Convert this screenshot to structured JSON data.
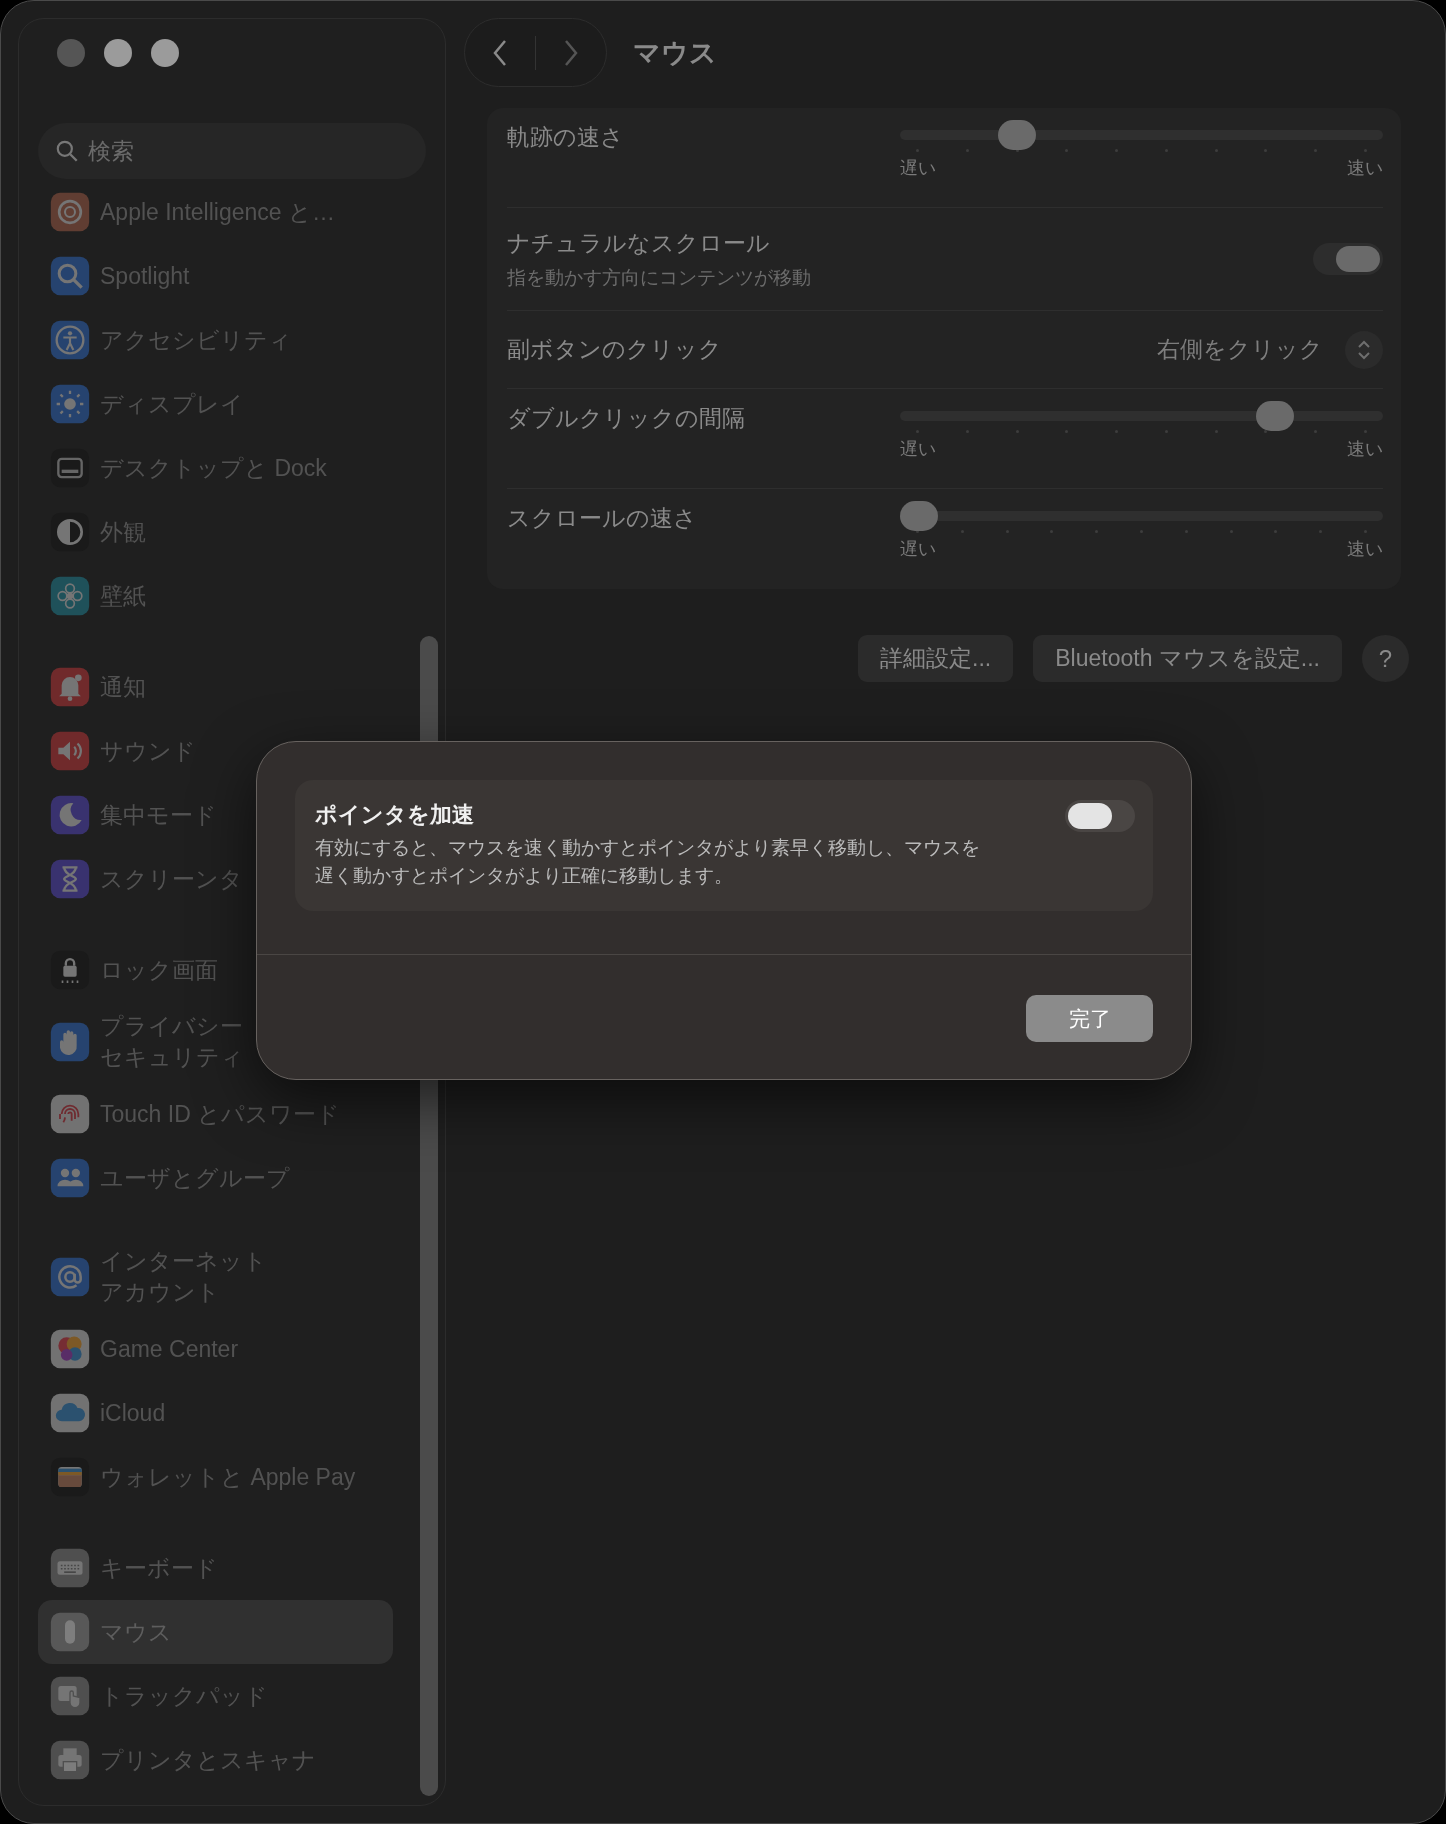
{
  "window": {
    "title": "マウス"
  },
  "sidebar": {
    "search": {
      "placeholder": "検索"
    },
    "groups": [
      {
        "items": [
          {
            "label": "Apple Intelligence と…",
            "kind": "intelligence",
            "selected": false
          },
          {
            "label": "Spotlight",
            "kind": "spotlight",
            "selected": false
          },
          {
            "label": "アクセシビリティ",
            "kind": "accessibility",
            "selected": false
          },
          {
            "label": "ディスプレイ",
            "kind": "display",
            "selected": false
          },
          {
            "label": "デスクトップと Dock",
            "kind": "desktop",
            "selected": false
          },
          {
            "label": "外観",
            "kind": "appearance",
            "selected": false
          },
          {
            "label": "壁紙",
            "kind": "wallpaper",
            "selected": false
          }
        ]
      },
      {
        "items": [
          {
            "label": "通知",
            "kind": "notifications",
            "selected": false
          },
          {
            "label": "サウンド",
            "kind": "sound",
            "selected": false
          },
          {
            "label": "集中モード",
            "kind": "focus",
            "selected": false
          },
          {
            "label": "スクリーンタ",
            "kind": "screentime",
            "selected": false
          }
        ]
      },
      {
        "items": [
          {
            "label": "ロック画面",
            "kind": "lock",
            "selected": false
          },
          {
            "lines": [
              "プライバシー",
              "セキュリティ"
            ],
            "kind": "privacy",
            "selected": false
          },
          {
            "label": "Touch ID とパスワード",
            "kind": "touchid",
            "selected": false
          },
          {
            "label": "ユーザとグループ",
            "kind": "users",
            "selected": false
          }
        ]
      },
      {
        "items": [
          {
            "lines": [
              "インターネット",
              "アカウント"
            ],
            "kind": "internet",
            "selected": false
          },
          {
            "label": "Game Center",
            "kind": "gamecenter",
            "selected": false
          },
          {
            "label": "iCloud",
            "kind": "icloud",
            "selected": false
          },
          {
            "label": "ウォレットと Apple Pay",
            "kind": "wallet",
            "selected": false
          }
        ]
      },
      {
        "items": [
          {
            "label": "キーボード",
            "kind": "keyboard",
            "selected": false
          },
          {
            "label": "マウス",
            "kind": "mouse",
            "selected": true
          },
          {
            "label": "トラックパッド",
            "kind": "trackpad",
            "selected": false
          },
          {
            "label": "プリンタとスキャナ",
            "kind": "printer",
            "selected": false
          }
        ]
      }
    ]
  },
  "settings": [
    {
      "kind": "slider",
      "label": "軌跡の速さ",
      "level": 0.22,
      "min_label": "遅い",
      "max_label": "速い"
    },
    {
      "kind": "toggle",
      "label": "ナチュラルなスクロール",
      "description": "指を動かす方向にコンテンツが移動",
      "on": true
    },
    {
      "kind": "popup",
      "label": "副ボタンのクリック",
      "value": "右側をクリック"
    },
    {
      "kind": "slider",
      "label": "ダブルクリックの間隔",
      "level": 0.8,
      "min_label": "遅い",
      "max_label": "速い"
    },
    {
      "kind": "slider",
      "label": "スクロールの速さ",
      "level": 0.0,
      "min_label": "遅い",
      "max_label": "速い"
    }
  ],
  "buttons": [
    "詳細設定...",
    "Bluetooth マウスを設定...",
    "?"
  ],
  "sheet": {
    "setting": {
      "title": "ポインタを加速",
      "description": "有効にすると、マウスを速く動かすとポインタがより素早く移動し、マウスを遅く動かすとポインタがより正確に移動します。",
      "on": false
    },
    "done_button": "完了"
  }
}
